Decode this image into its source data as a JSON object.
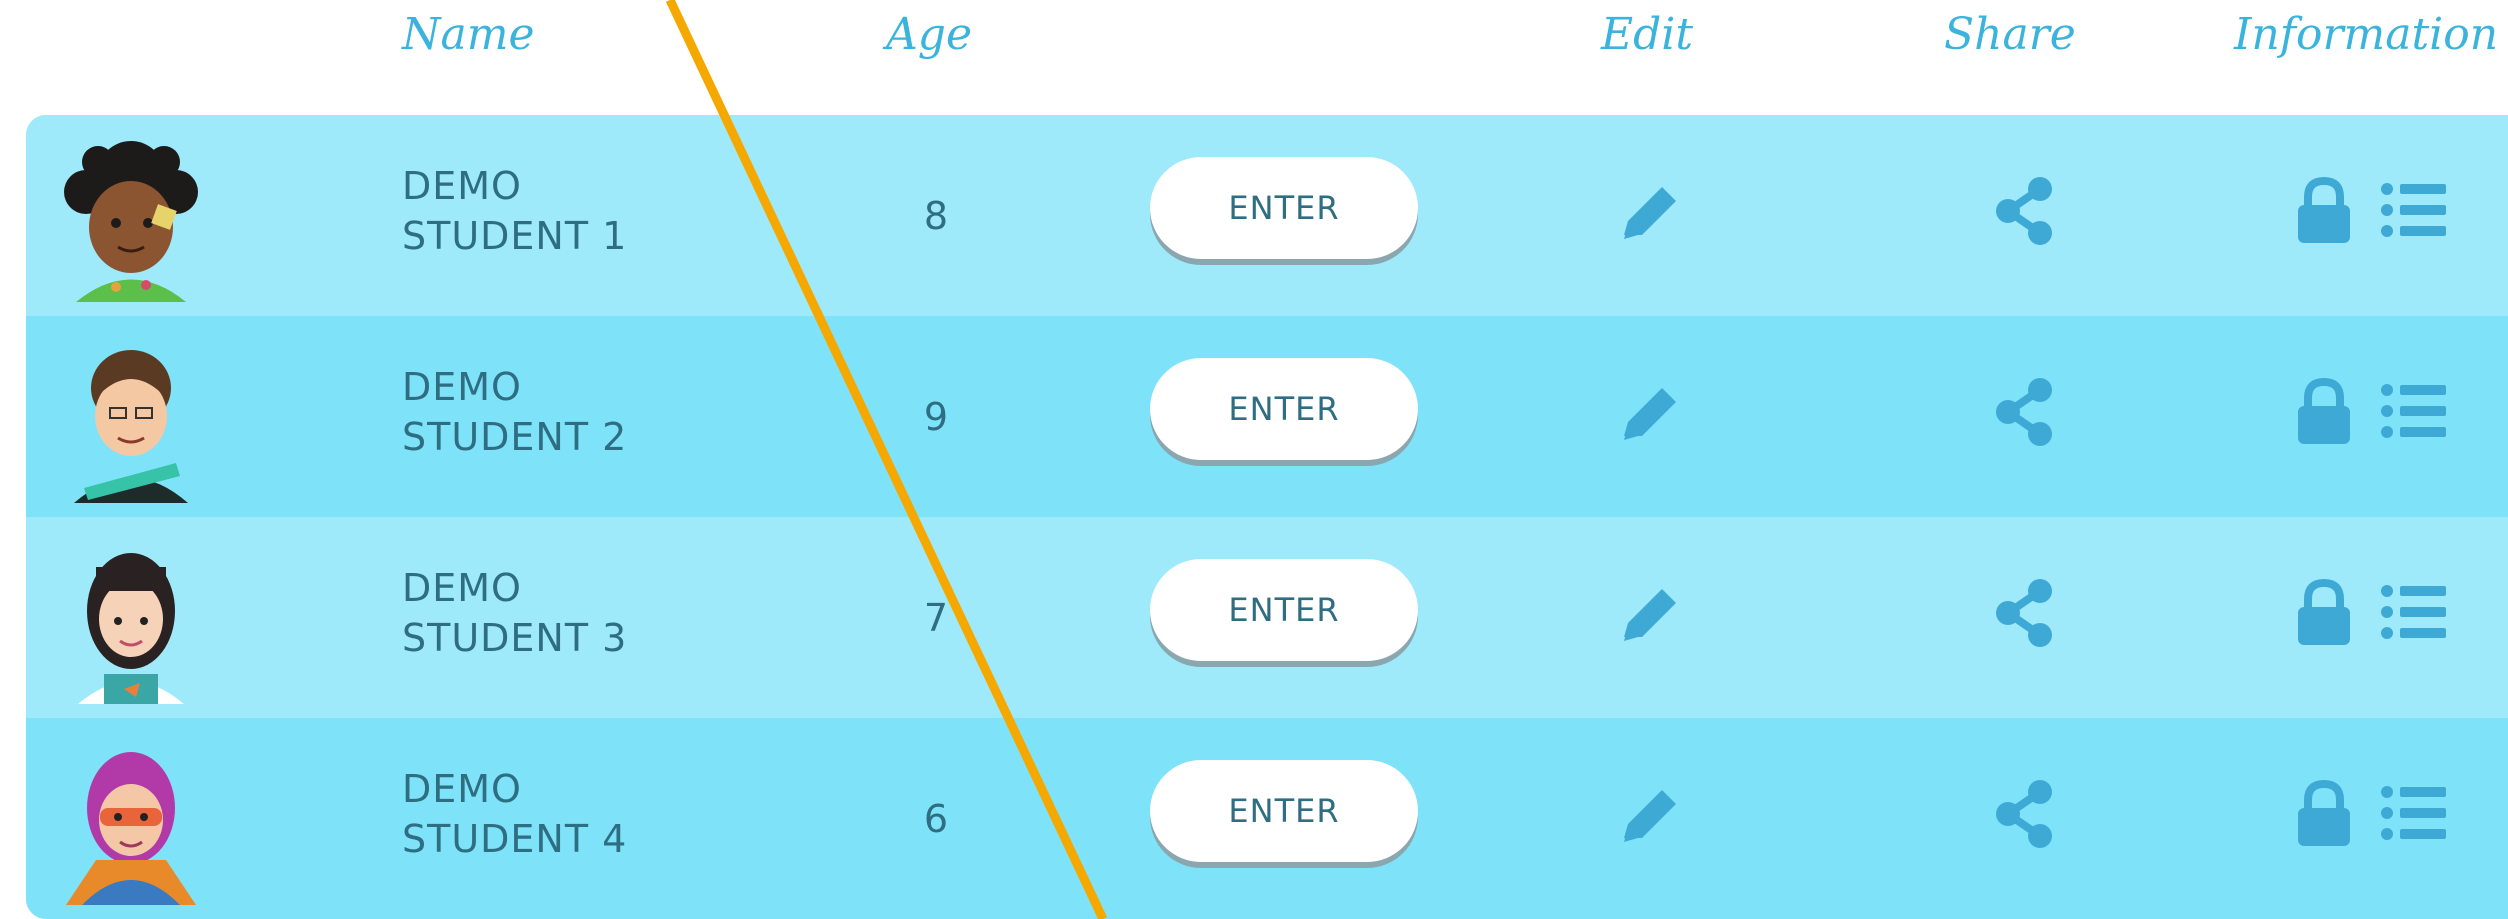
{
  "header": {
    "name_label": "Name",
    "age_label": "Age",
    "edit_label": "Edit",
    "share_label": "Share",
    "information_label": "Information"
  },
  "rows": [
    {
      "name_line1": "DEMO",
      "name_line2": "STUDENT 1",
      "age": "8",
      "enter_label": "ENTER",
      "avatar": "avatar-girl-curly-hair"
    },
    {
      "name_line1": "DEMO",
      "name_line2": "STUDENT 2",
      "age": "9",
      "enter_label": "ENTER",
      "avatar": "avatar-boy-brown-hair"
    },
    {
      "name_line1": "DEMO",
      "name_line2": "STUDENT 3",
      "age": "7",
      "enter_label": "ENTER",
      "avatar": "avatar-girl-black-hair"
    },
    {
      "name_line1": "DEMO",
      "name_line2": "STUDENT 4",
      "age": "6",
      "enter_label": "ENTER",
      "avatar": "avatar-girl-purple-hair-hero"
    }
  ],
  "icons": {
    "edit": "pencil-icon",
    "share": "share-icon",
    "lock": "lock-icon",
    "list": "list-icon"
  },
  "colors": {
    "header_text": "#3ab3dd",
    "row_light": "#9eeafb",
    "row_dark": "#7ee3f9",
    "icon": "#3fa9d6",
    "text": "#2e6d82",
    "annotation_line": "#f5a800"
  }
}
